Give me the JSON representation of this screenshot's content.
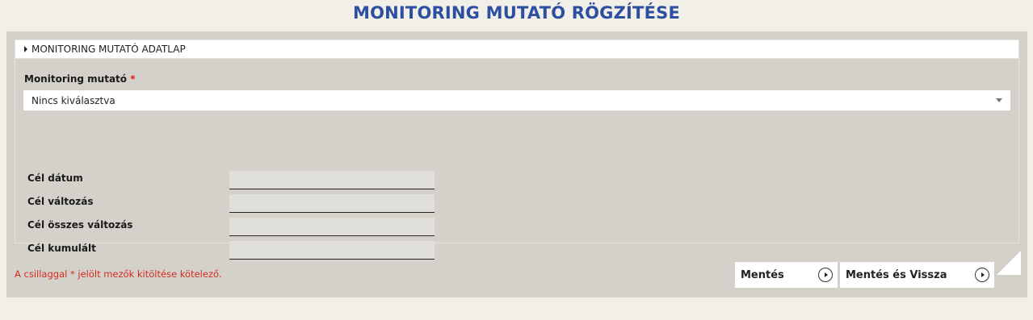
{
  "page": {
    "title": "MONITORING MUTATÓ RÖGZÍTÉSE"
  },
  "section": {
    "header": "MONITORING MUTATÓ ADATLAP",
    "indicator_label": "Monitoring mutató",
    "required_mark": "*",
    "indicator_value": "Nincs kiválasztva"
  },
  "fields": [
    {
      "label": "Cél dátum",
      "value": ""
    },
    {
      "label": "Cél változás",
      "value": ""
    },
    {
      "label": "Cél összes változás",
      "value": ""
    },
    {
      "label": "Cél kumulált",
      "value": ""
    }
  ],
  "footer": {
    "required_note": "A csillaggal * jelölt mezők kitöltése kötelező.",
    "save_label": "Mentés",
    "save_back_label": "Mentés és Vissza"
  },
  "colors": {
    "title": "#2c4fa1",
    "panel": "#d4d1ca",
    "required": "#d42b1e"
  }
}
